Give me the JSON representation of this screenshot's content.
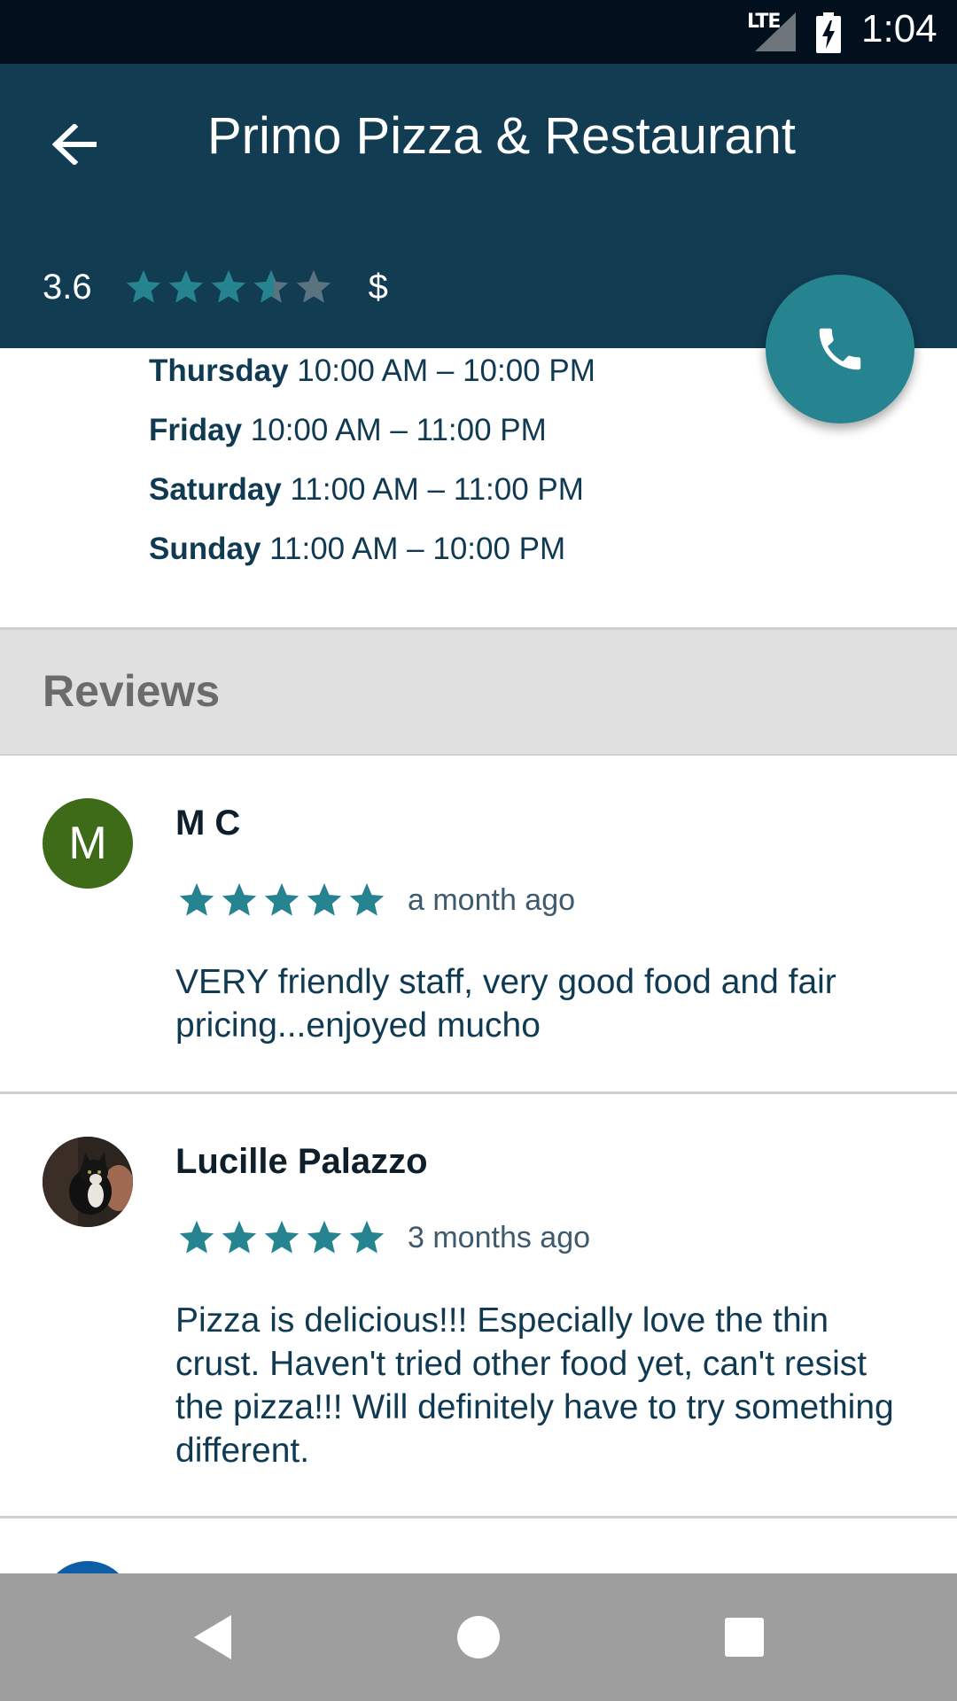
{
  "status_bar": {
    "network": "LTE",
    "time": "1:04"
  },
  "app_bar": {
    "title": "Primo Pizza & Restaurant",
    "rating": "3.6",
    "rating_stars": 3.6,
    "price_level": "$",
    "colors": {
      "background": "#123c52",
      "accent": "#25848f"
    }
  },
  "hours": [
    {
      "day": "Thursday",
      "time": "10:00 AM – 10:00 PM"
    },
    {
      "day": "Friday",
      "time": "10:00 AM – 11:00 PM"
    },
    {
      "day": "Saturday",
      "time": "11:00 AM – 11:00 PM"
    },
    {
      "day": "Sunday",
      "time": "11:00 AM – 10:00 PM"
    }
  ],
  "reviews_section": {
    "header": "Reviews",
    "items": [
      {
        "author": "M C",
        "avatar_letter": "M",
        "stars": 5,
        "time": "a month ago",
        "text": "VERY friendly staff, very good food and fair pricing...enjoyed mucho"
      },
      {
        "author": "Lucille Palazzo",
        "avatar": "cat-photo-avatar",
        "stars": 5,
        "time": "3 months ago",
        "text": "Pizza is delicious!!! Especially love the thin crust. Haven't tried other food yet, can't resist the pizza!!! Will definitely have to try something different."
      }
    ]
  },
  "icons": {
    "back": "arrow-left-icon",
    "call": "phone-icon",
    "nav_back": "triangle-back-icon",
    "nav_home": "circle-home-icon",
    "nav_recents": "square-recents-icon"
  }
}
